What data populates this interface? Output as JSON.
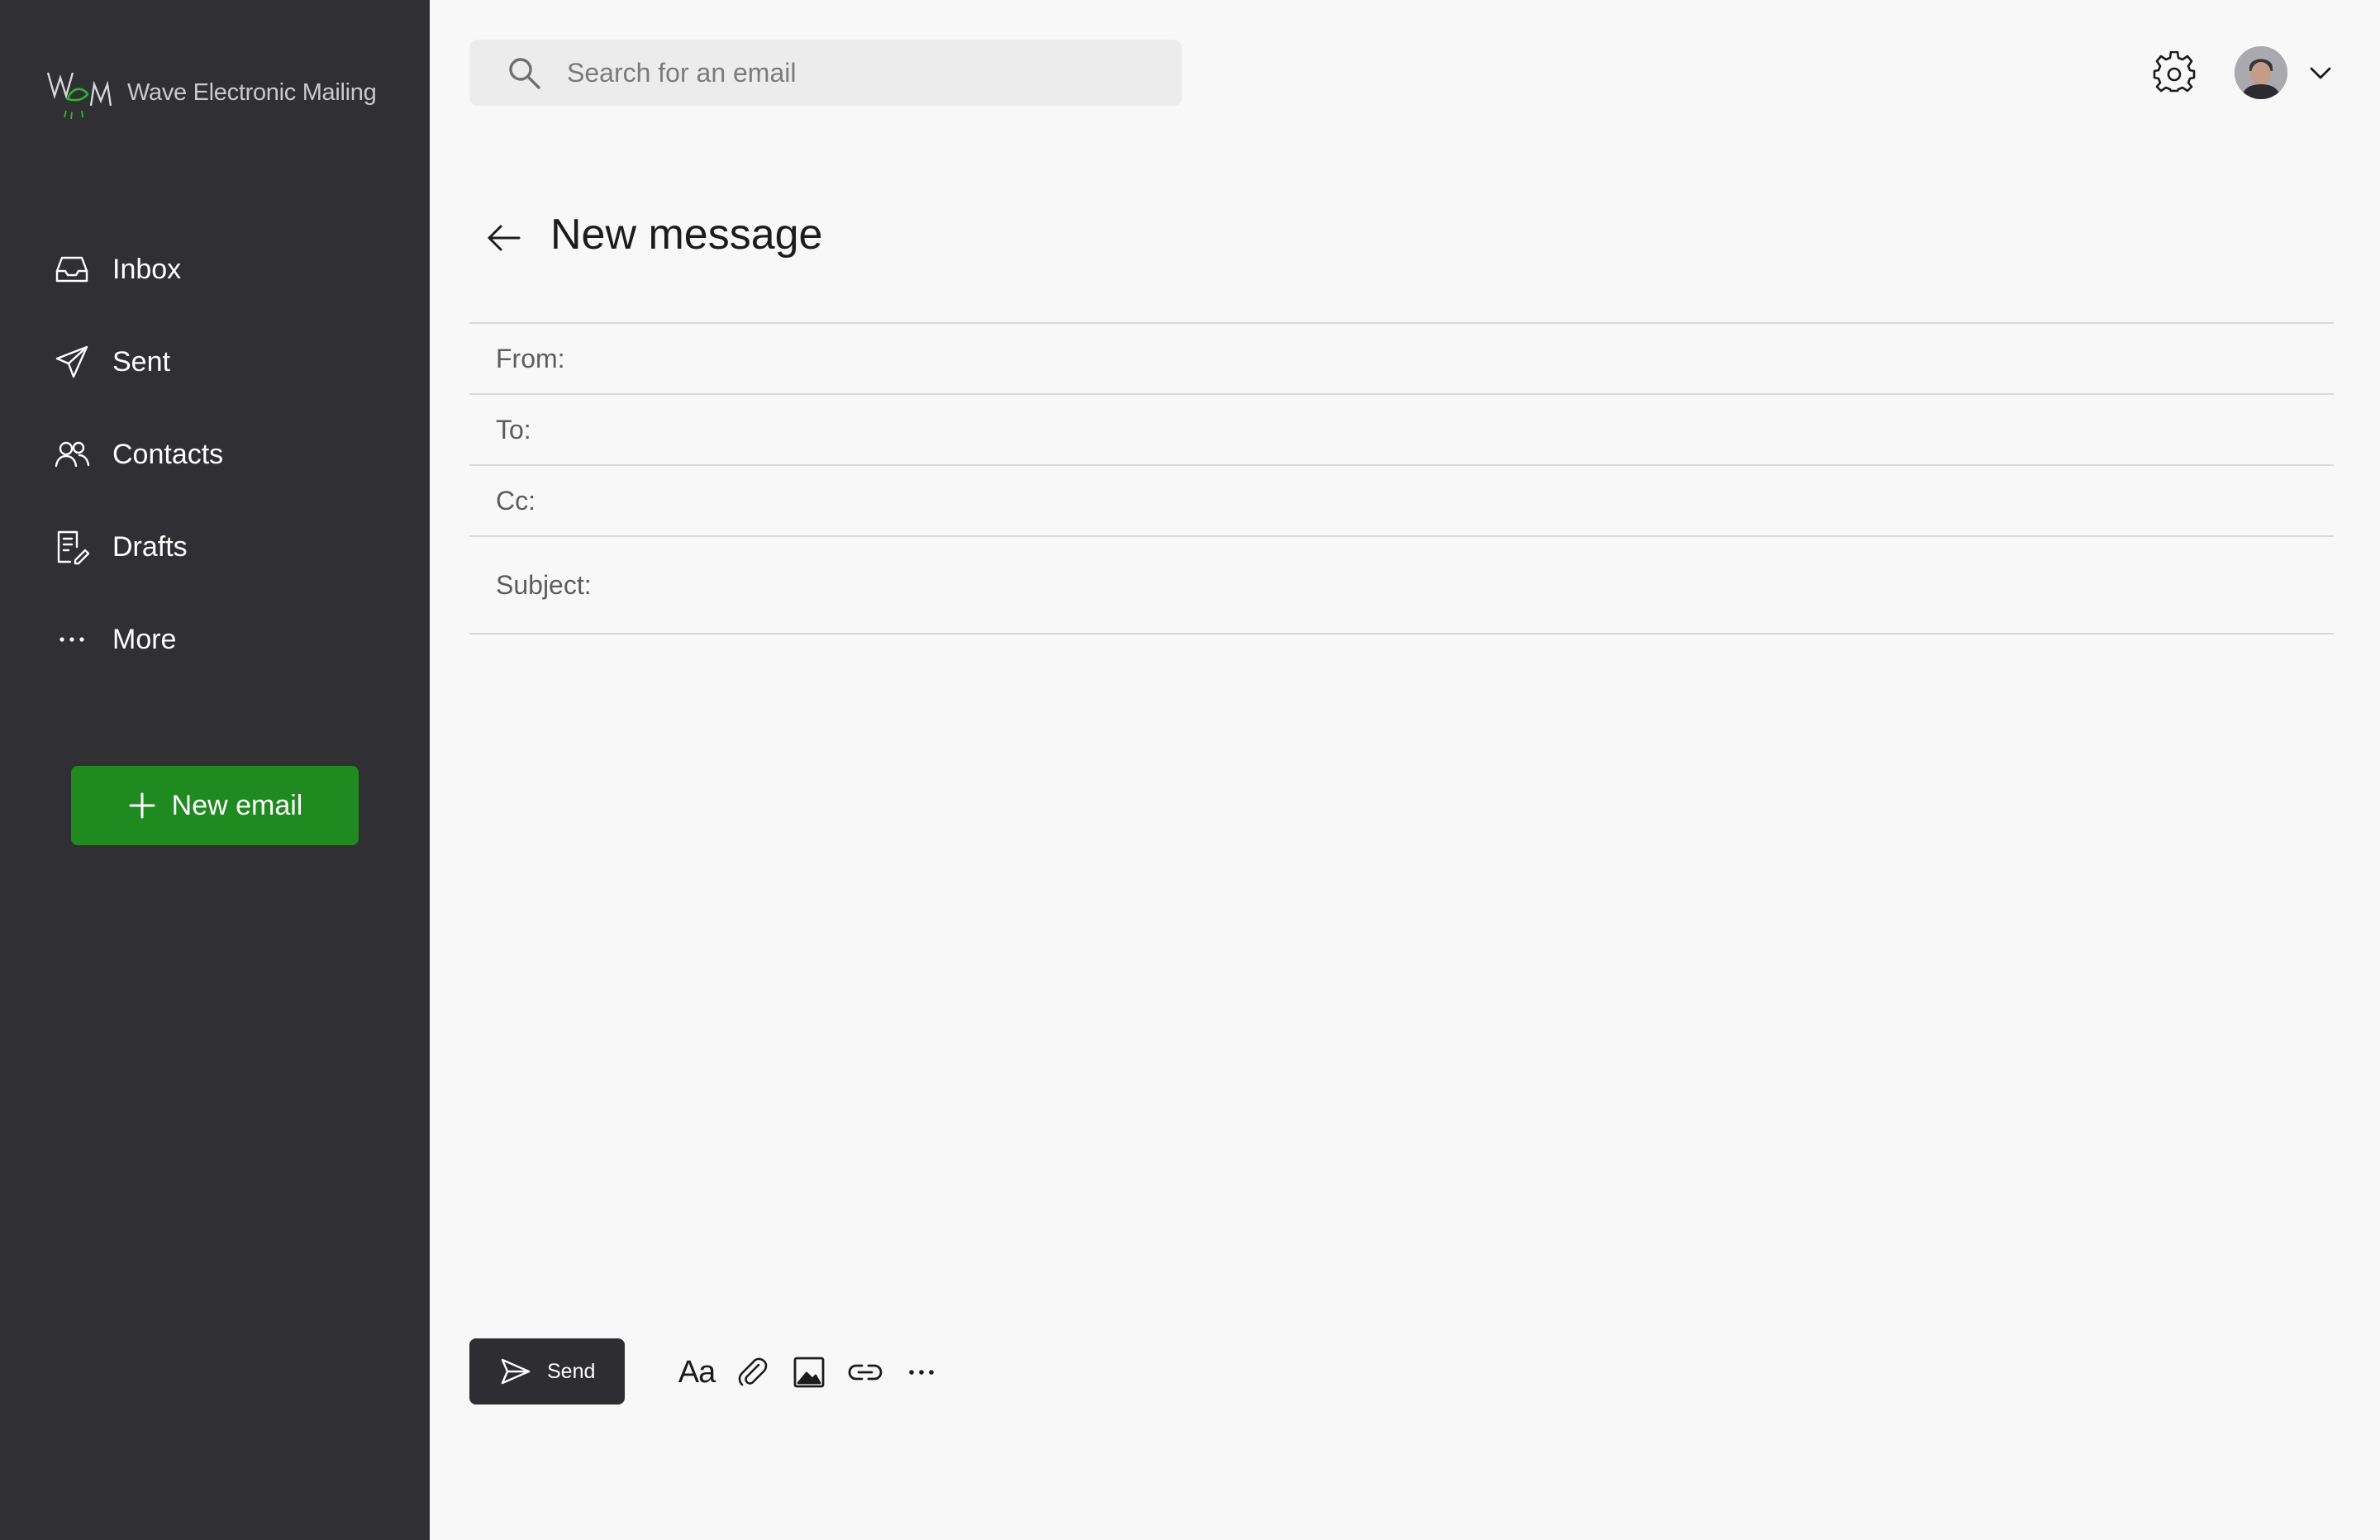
{
  "app": {
    "name": "Wave Electronic Mailing",
    "accent_color": "#1f8a1f",
    "sidebar_color": "#303034"
  },
  "sidebar": {
    "items": [
      {
        "label": "Inbox",
        "icon": "inbox-icon"
      },
      {
        "label": "Sent",
        "icon": "paper-plane-icon"
      },
      {
        "label": "Contacts",
        "icon": "contacts-icon"
      },
      {
        "label": "Drafts",
        "icon": "drafts-icon"
      },
      {
        "label": "More",
        "icon": "more-dots-icon"
      }
    ],
    "new_email_label": "New email"
  },
  "header": {
    "search_placeholder": "Search for an email"
  },
  "compose": {
    "title": "New message",
    "from_label": "From:",
    "to_label": "To:",
    "cc_label": "Cc:",
    "subject_label": "Subject:",
    "send_label": "Send",
    "format_label": "Aa"
  }
}
